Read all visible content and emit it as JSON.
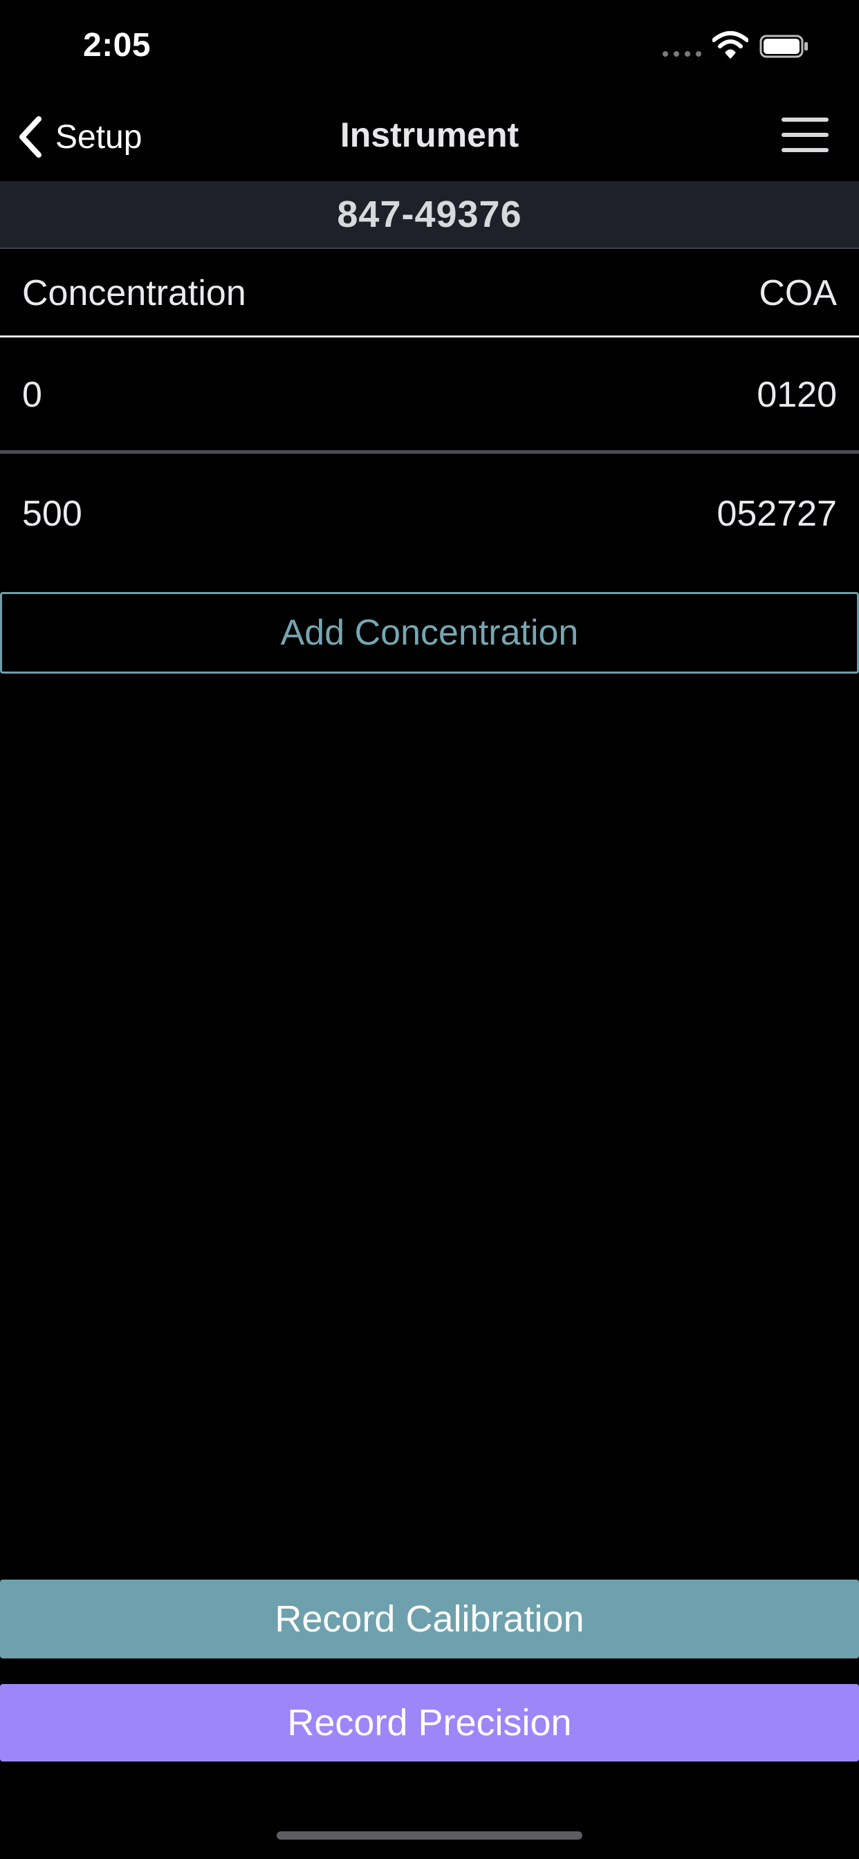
{
  "status_bar": {
    "time": "2:05",
    "signal_icon": "cellular-signal-icon",
    "wifi_icon": "wifi-icon",
    "battery_icon": "battery-icon"
  },
  "nav": {
    "back_label": "Setup",
    "back_icon": "chevron-left-icon",
    "title": "Instrument",
    "menu_icon": "hamburger-menu-icon"
  },
  "serial_number": "847-49376",
  "table": {
    "headers": [
      "Concentration",
      "COA"
    ],
    "rows": [
      [
        "0",
        "0120"
      ],
      [
        "500",
        "052727"
      ]
    ]
  },
  "buttons": {
    "add_concentration": "Add Concentration",
    "record_calibration": "Record Calibration",
    "record_precision": "Record Precision"
  },
  "colors": {
    "background": "#000000",
    "serial_band": "#1e2129",
    "accent_teal": "#6ea1ad",
    "accent_purple": "#9d86f8"
  }
}
